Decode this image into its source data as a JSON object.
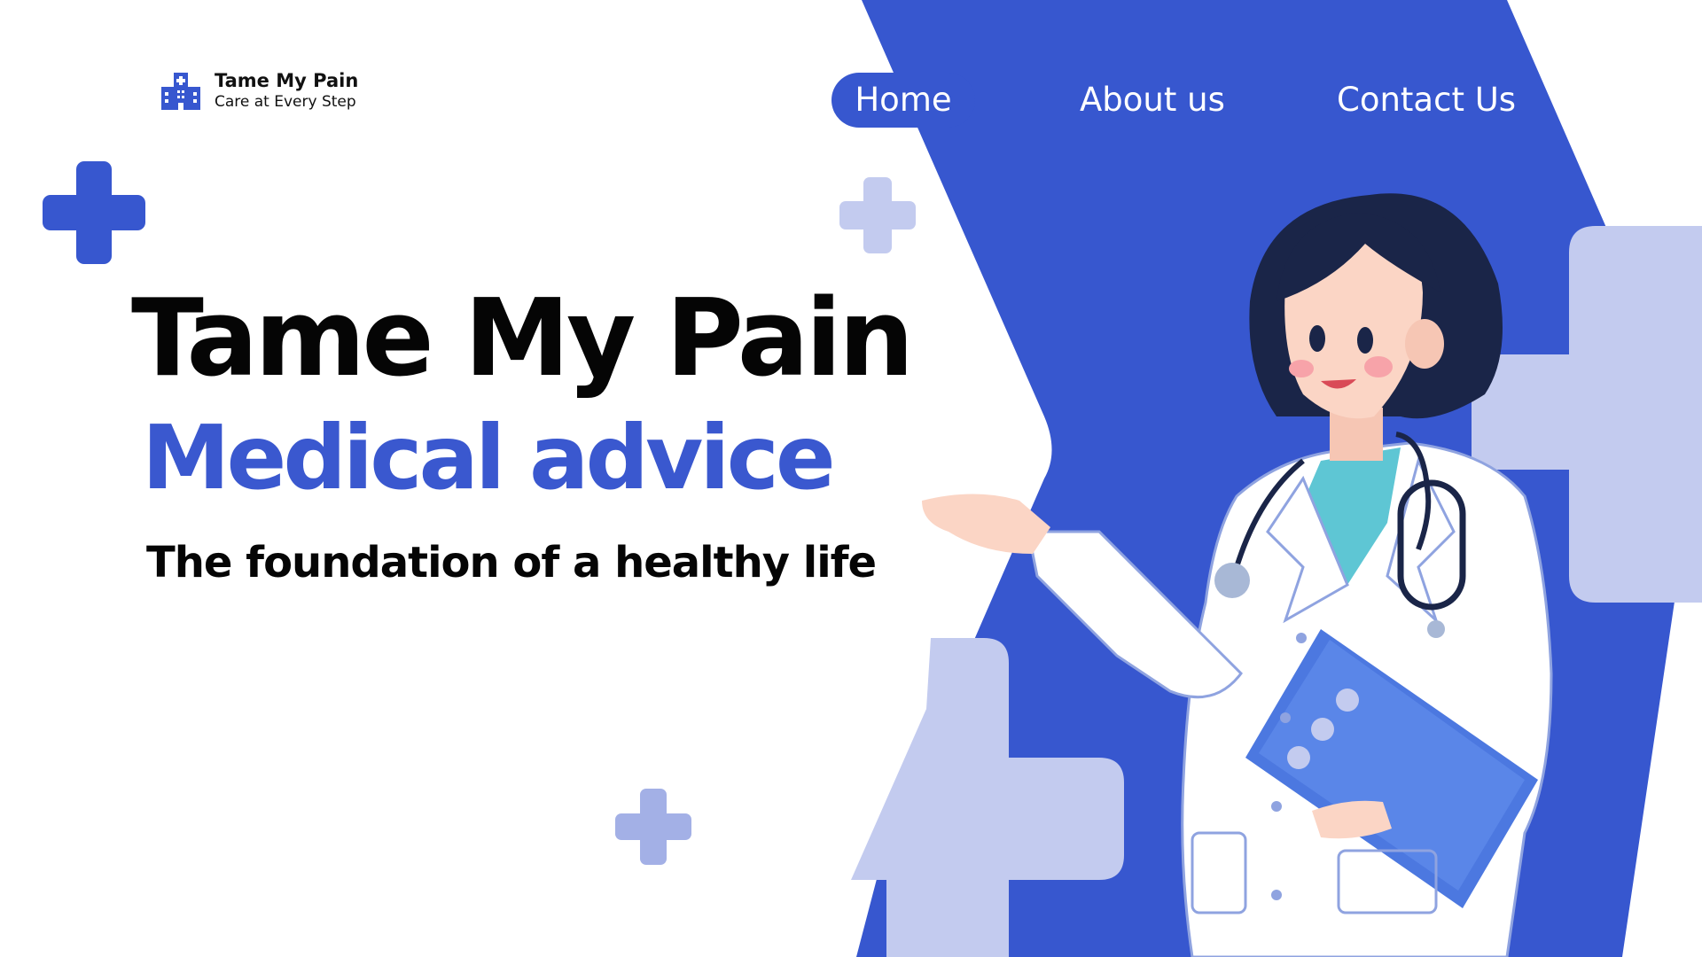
{
  "brand": {
    "name": "Tame My Pain",
    "tagline": "Care at Every Step",
    "logo_icon": "hospital-building-icon"
  },
  "nav": {
    "items": [
      {
        "label": "Home",
        "active": true
      },
      {
        "label": "About us",
        "active": false
      },
      {
        "label": "Contact Us",
        "active": false
      }
    ]
  },
  "hero": {
    "title": "Tame My Pain",
    "subtitle": "Medical advice",
    "tagline": "The foundation of a healthy life"
  },
  "decor": {
    "illustration": "doctor-illustration",
    "icons": [
      "plus-cross-icon"
    ]
  },
  "colors": {
    "primary": "#3757cf",
    "light": "#c3cbef",
    "mid": "#a3b0e6",
    "text": "#050505",
    "background": "#ffffff"
  }
}
